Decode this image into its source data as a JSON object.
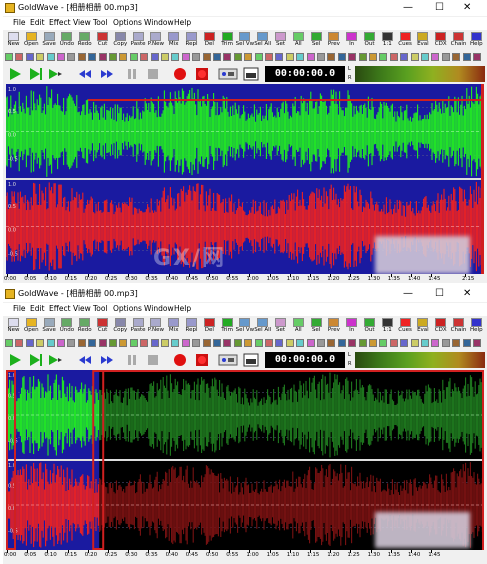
{
  "window_1": {
    "title": "GoldWave - [相册相册 00.mp3]",
    "menu": [
      "File",
      "Edit",
      "Effect",
      "View",
      "Tool",
      "Options",
      "Window",
      "Help"
    ],
    "toolbar": [
      "New",
      "Open",
      "Save",
      "Undo",
      "Redo",
      "Cut",
      "Copy",
      "Paste",
      "P.New",
      "Mix",
      "Repl",
      "Del",
      "Trim",
      "Sel Vw",
      "Sel All",
      "Set",
      "All",
      "Sel",
      "Prev",
      "In",
      "Out",
      "1:1",
      "Cues",
      "Eval",
      "CDX",
      "Chain",
      "Help"
    ],
    "time_display": "00:00:00.0",
    "meter_labels": [
      "L",
      "R"
    ],
    "channel_axis": [
      "1.0",
      "0.5",
      "0.0",
      "-0.5",
      "1.0",
      "0.5",
      "0.0",
      "-0.5"
    ],
    "ruler_labels": [
      "0:00",
      "0:05",
      "0:10",
      "0:15",
      "0:20",
      "0:25",
      "0:30",
      "0:35",
      "0:40",
      "0:45",
      "0:50",
      "0:55",
      "1:00",
      "1:05",
      "1:10",
      "1:15",
      "1:20",
      "1:25",
      "1:30",
      "1:35",
      "1:40",
      "1:45",
      "2:15"
    ],
    "watermark": "GX/网"
  },
  "window_2": {
    "title": "GoldWave - [相册相册 00.mp3]",
    "menu": [
      "File",
      "Edit",
      "Effect",
      "View",
      "Tool",
      "Options",
      "Window",
      "Help"
    ],
    "toolbar": [
      "New",
      "Open",
      "Save",
      "Undo",
      "Redo",
      "Cut",
      "Copy",
      "Paste",
      "P.New",
      "Mix",
      "Repl",
      "Del",
      "Trim",
      "Sel Vw",
      "Sel All",
      "Set",
      "All",
      "Sel",
      "Prev",
      "In",
      "Out",
      "1:1",
      "Cues",
      "Eval",
      "CDX",
      "Chain",
      "Help"
    ],
    "time_display": "00:00:00.0",
    "meter_labels": [
      "L",
      "R"
    ],
    "channel_axis": [
      "1.0",
      "0.5",
      "0.0",
      "-0.5",
      "1.0",
      "0.5",
      "0.0",
      "-0.5"
    ],
    "ruler_labels": [
      "0:00",
      "0:05",
      "0:10",
      "0:15",
      "0:20",
      "0:25",
      "0:30",
      "0:35",
      "0:40",
      "0:45",
      "0:50",
      "0:55",
      "1:00",
      "1:05",
      "1:10",
      "1:15",
      "1:20",
      "1:25",
      "1:30",
      "1:35",
      "1:40",
      "1:45"
    ]
  },
  "window_controls": [
    "—",
    "☐",
    "✕"
  ],
  "colors": {
    "wave_bg_selected": "#1a1aa0",
    "wave_green": "#22ee22",
    "wave_red": "#ee2222",
    "unselected_green": "#1f7a1f",
    "unselected_red": "#7a1212",
    "selection_marker": "#d02020"
  },
  "selection_2_fraction": [
    0.0,
    0.195
  ],
  "icons": [
    "play-icon",
    "play-selection-icon",
    "play-from-icon",
    "rewind-icon",
    "fast-forward-icon",
    "pause-icon",
    "stop-icon",
    "record-icon",
    "record-selection-icon",
    "settings-icon",
    "meter-icon"
  ]
}
